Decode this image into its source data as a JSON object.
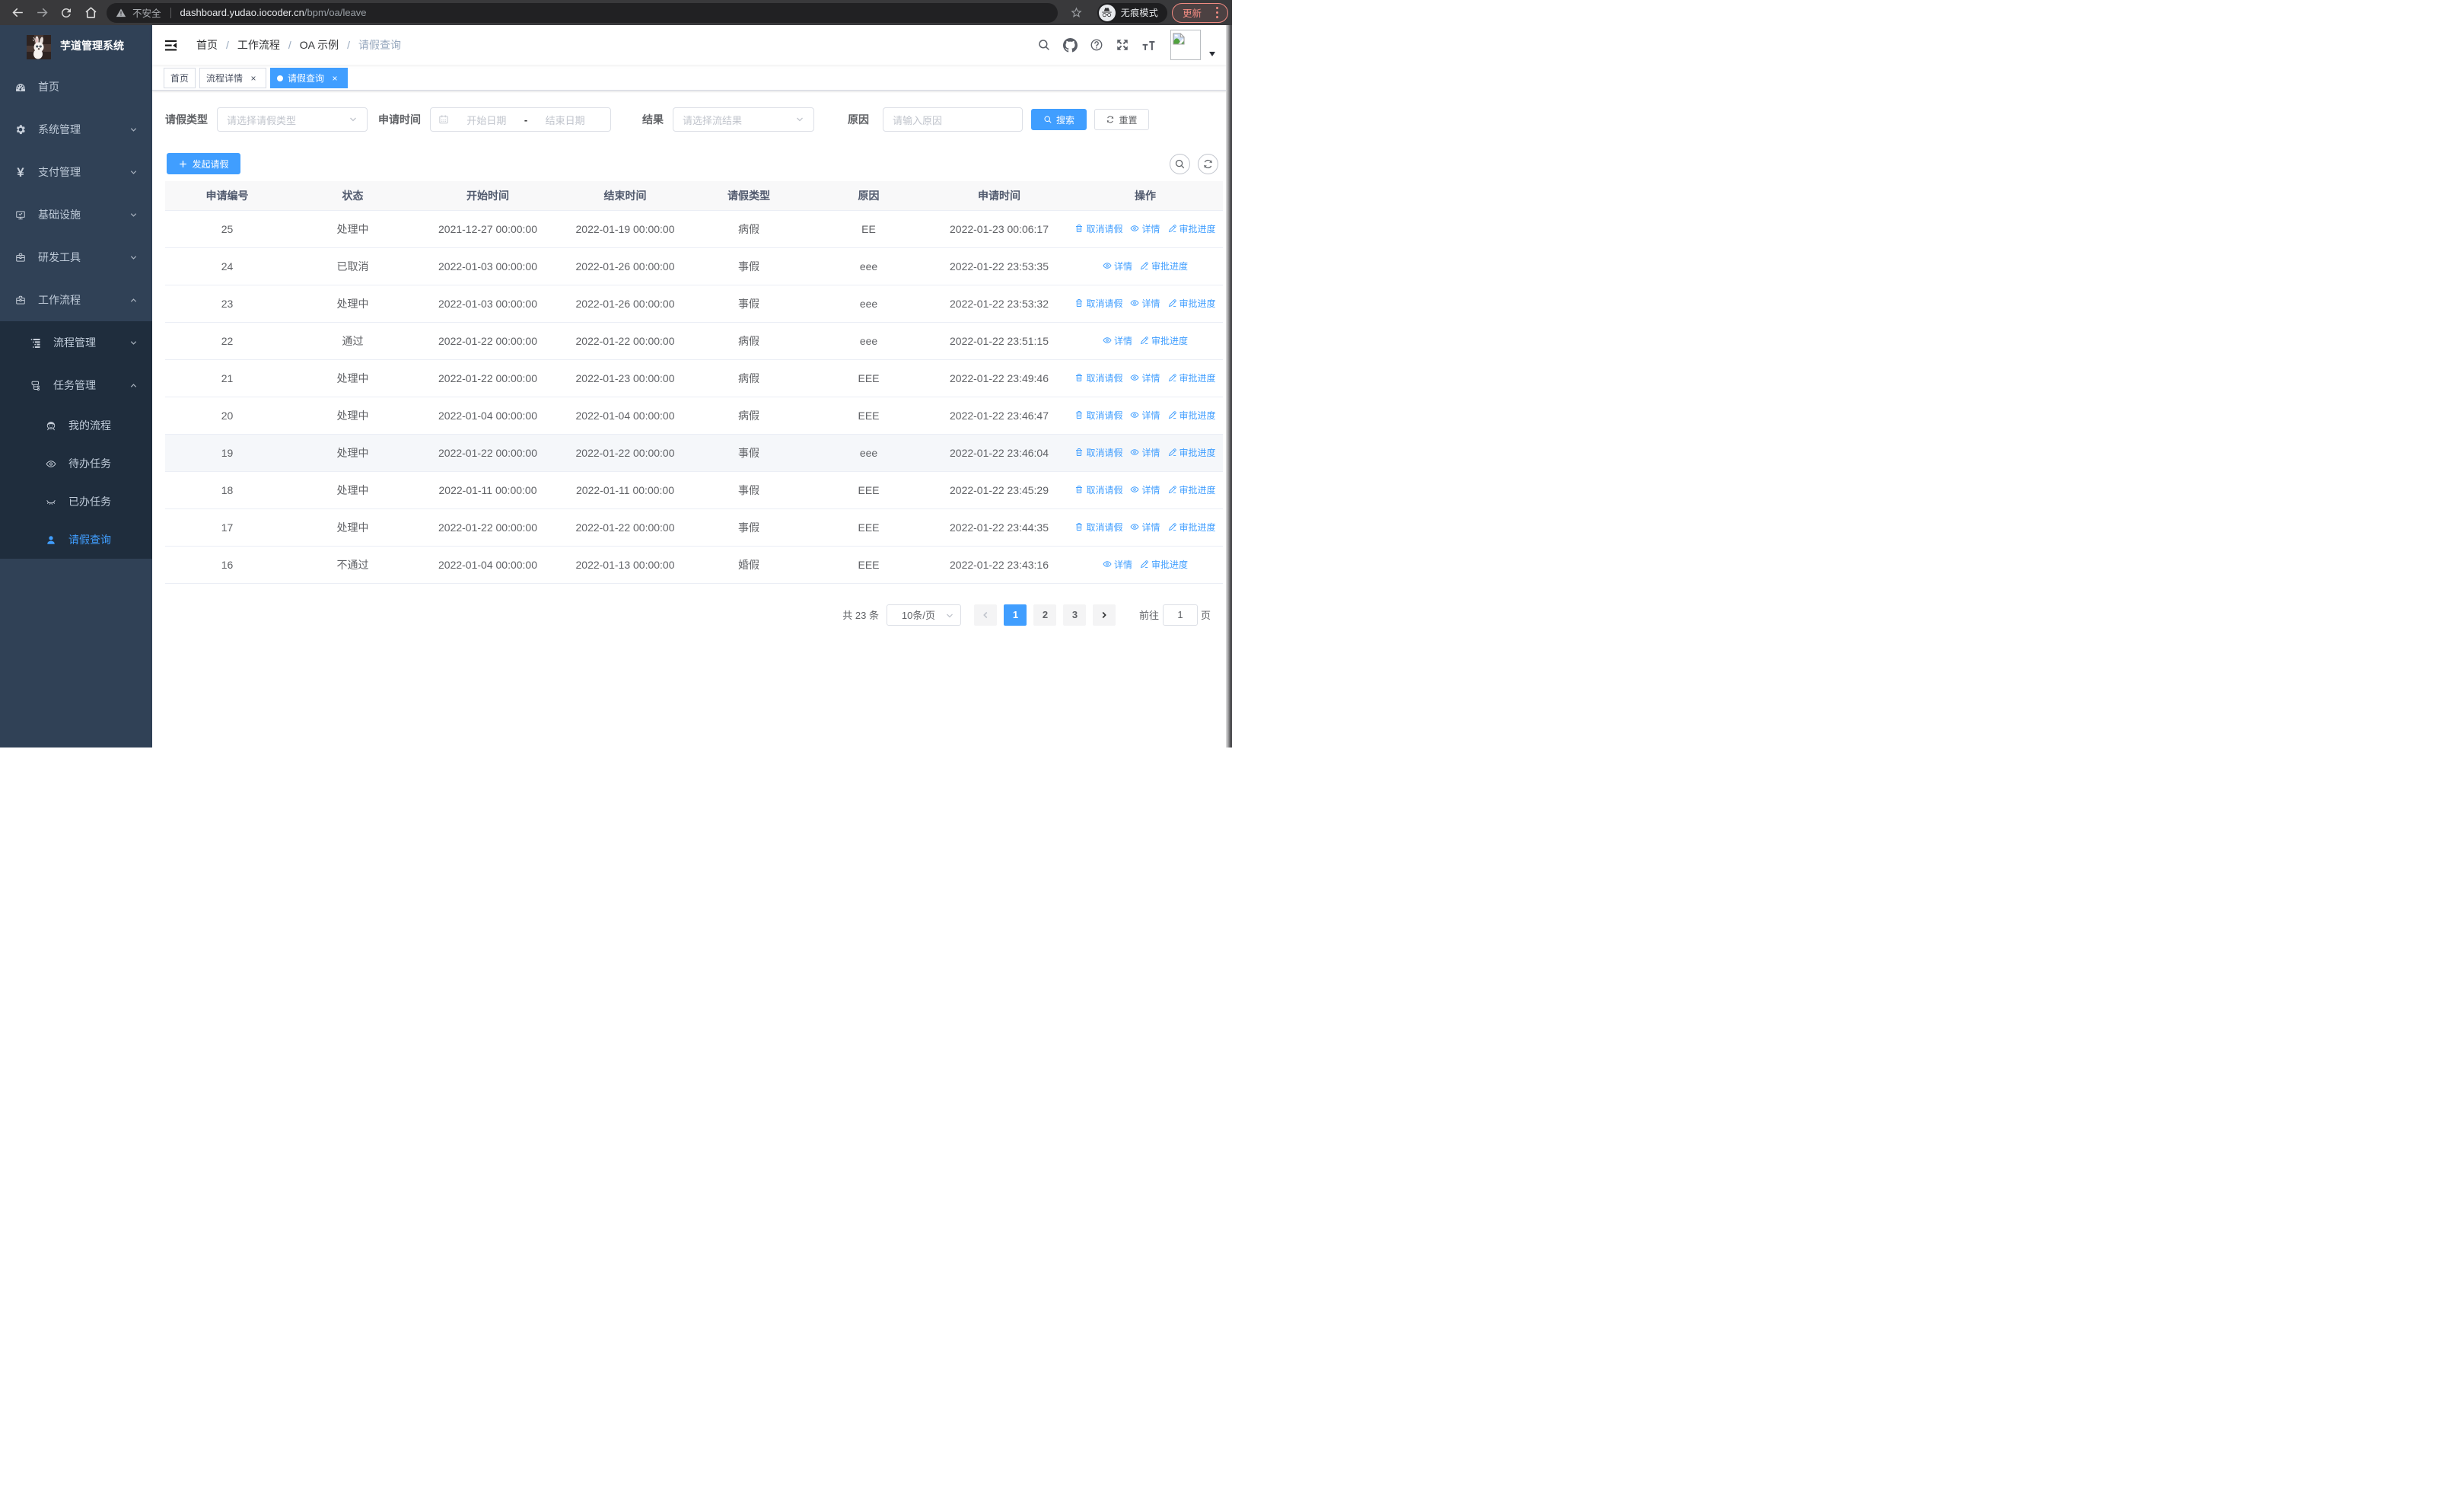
{
  "browser": {
    "security_label": "不安全",
    "url_host": "dashboard.yudao.iocoder.cn",
    "url_path": "/bpm/oa/leave",
    "incognito_label": "无痕模式",
    "update_label": "更新"
  },
  "sidebar": {
    "title": "芋道管理系统",
    "menu": [
      {
        "label": "首页",
        "icon": "dashboard-icon",
        "level": 1
      },
      {
        "label": "系统管理",
        "icon": "gear-icon",
        "level": 1,
        "arrow": "down"
      },
      {
        "label": "支付管理",
        "icon": "yen-icon",
        "level": 1,
        "arrow": "down"
      },
      {
        "label": "基础设施",
        "icon": "monitor-icon",
        "level": 1,
        "arrow": "down"
      },
      {
        "label": "研发工具",
        "icon": "toolbox-icon",
        "level": 1,
        "arrow": "down"
      },
      {
        "label": "工作流程",
        "icon": "workflow-icon",
        "level": 1,
        "arrow": "up"
      },
      {
        "label": "流程管理",
        "icon": "list-tree-icon",
        "level": 2,
        "arrow": "down",
        "sub": true
      },
      {
        "label": "任务管理",
        "icon": "org-tree-icon",
        "level": 2,
        "arrow": "up",
        "sub": true
      },
      {
        "label": "我的流程",
        "icon": "face-icon",
        "level": 3,
        "sub": true
      },
      {
        "label": "待办任务",
        "icon": "eye-open-icon",
        "level": 3,
        "sub": true
      },
      {
        "label": "已办任务",
        "icon": "eye-closed-icon",
        "level": 3,
        "sub": true
      },
      {
        "label": "请假查询",
        "icon": "user-icon",
        "level": 3,
        "sub": true,
        "active": true
      }
    ]
  },
  "breadcrumb": [
    "首页",
    "工作流程",
    "OA 示例",
    "请假查询"
  ],
  "tags": [
    {
      "label": "首页",
      "closable": false,
      "active": false
    },
    {
      "label": "流程详情",
      "closable": true,
      "active": false
    },
    {
      "label": "请假查询",
      "closable": true,
      "active": true
    }
  ],
  "filters": {
    "leave_type_label": "请假类型",
    "leave_type_placeholder": "请选择请假类型",
    "apply_time_label": "申请时间",
    "start_placeholder": "开始日期",
    "range_separator": "-",
    "end_placeholder": "结束日期",
    "result_label": "结果",
    "result_placeholder": "请选择流结果",
    "reason_label": "原因",
    "reason_placeholder": "请输入原因",
    "search_label": "搜索",
    "reset_label": "重置"
  },
  "toolbar": {
    "create_label": "发起请假"
  },
  "table": {
    "columns": [
      "申请编号",
      "状态",
      "开始时间",
      "结束时间",
      "请假类型",
      "原因",
      "申请时间",
      "操作"
    ],
    "action_labels": {
      "cancel": "取消请假",
      "detail": "详情",
      "progress": "审批进度"
    },
    "rows": [
      {
        "id": "25",
        "status": "处理中",
        "start": "2021-12-27 00:00:00",
        "end": "2022-01-19 00:00:00",
        "type": "病假",
        "reason": "EE",
        "applied": "2022-01-23 00:06:17",
        "actions": [
          "cancel",
          "detail",
          "progress"
        ]
      },
      {
        "id": "24",
        "status": "已取消",
        "start": "2022-01-03 00:00:00",
        "end": "2022-01-26 00:00:00",
        "type": "事假",
        "reason": "eee",
        "applied": "2022-01-22 23:53:35",
        "actions": [
          "detail",
          "progress"
        ]
      },
      {
        "id": "23",
        "status": "处理中",
        "start": "2022-01-03 00:00:00",
        "end": "2022-01-26 00:00:00",
        "type": "事假",
        "reason": "eee",
        "applied": "2022-01-22 23:53:32",
        "actions": [
          "cancel",
          "detail",
          "progress"
        ]
      },
      {
        "id": "22",
        "status": "通过",
        "start": "2022-01-22 00:00:00",
        "end": "2022-01-22 00:00:00",
        "type": "病假",
        "reason": "eee",
        "applied": "2022-01-22 23:51:15",
        "actions": [
          "detail",
          "progress"
        ]
      },
      {
        "id": "21",
        "status": "处理中",
        "start": "2022-01-22 00:00:00",
        "end": "2022-01-23 00:00:00",
        "type": "病假",
        "reason": "EEE",
        "applied": "2022-01-22 23:49:46",
        "actions": [
          "cancel",
          "detail",
          "progress"
        ]
      },
      {
        "id": "20",
        "status": "处理中",
        "start": "2022-01-04 00:00:00",
        "end": "2022-01-04 00:00:00",
        "type": "病假",
        "reason": "EEE",
        "applied": "2022-01-22 23:46:47",
        "actions": [
          "cancel",
          "detail",
          "progress"
        ]
      },
      {
        "id": "19",
        "status": "处理中",
        "start": "2022-01-22 00:00:00",
        "end": "2022-01-22 00:00:00",
        "type": "事假",
        "reason": "eee",
        "applied": "2022-01-22 23:46:04",
        "actions": [
          "cancel",
          "detail",
          "progress"
        ],
        "hover": true
      },
      {
        "id": "18",
        "status": "处理中",
        "start": "2022-01-11 00:00:00",
        "end": "2022-01-11 00:00:00",
        "type": "事假",
        "reason": "EEE",
        "applied": "2022-01-22 23:45:29",
        "actions": [
          "cancel",
          "detail",
          "progress"
        ]
      },
      {
        "id": "17",
        "status": "处理中",
        "start": "2022-01-22 00:00:00",
        "end": "2022-01-22 00:00:00",
        "type": "事假",
        "reason": "EEE",
        "applied": "2022-01-22 23:44:35",
        "actions": [
          "cancel",
          "detail",
          "progress"
        ]
      },
      {
        "id": "16",
        "status": "不通过",
        "start": "2022-01-04 00:00:00",
        "end": "2022-01-13 00:00:00",
        "type": "婚假",
        "reason": "EEE",
        "applied": "2022-01-22 23:43:16",
        "actions": [
          "detail",
          "progress"
        ]
      }
    ]
  },
  "pagination": {
    "total_label": "共 23 条",
    "page_size": "10条/页",
    "pages": [
      "1",
      "2",
      "3"
    ],
    "active_page": "1",
    "goto_label": "前往",
    "goto_value": "1",
    "page_label": "页"
  },
  "colors": {
    "accent": "#409EFF",
    "sidebar_bg": "#304156",
    "submenu_bg": "#1f2d3d",
    "update_chip": "#f28b82"
  }
}
